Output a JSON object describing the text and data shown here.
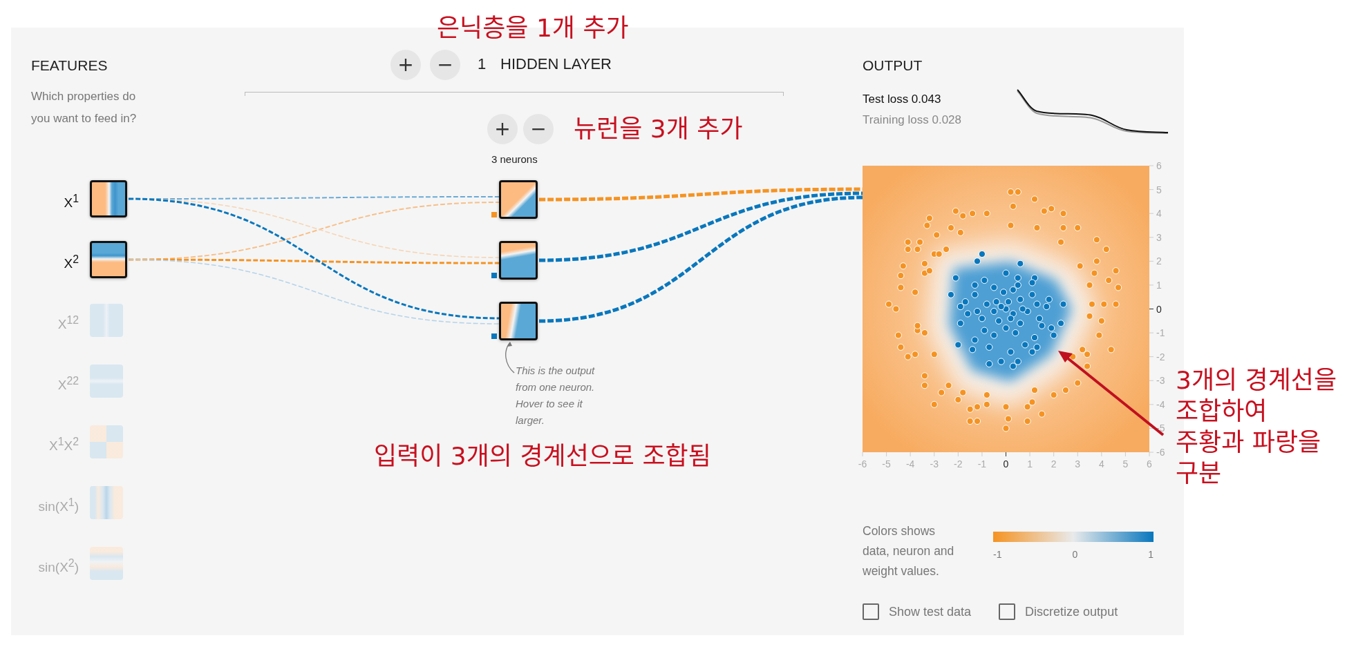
{
  "annotations": [
    {
      "lines": [
        "은닉층을 1개 추가"
      ]
    },
    {
      "lines": [
        "뉴런을 3개 추가"
      ]
    },
    {
      "lines": [
        "입력이 3개의 경계선으로 조합됨"
      ]
    },
    {
      "lines": [
        "3개의 경계선을",
        "조합하여",
        "주황과 파랑을",
        "구분"
      ]
    }
  ],
  "features": {
    "title": "FEATURES",
    "subtitle": [
      "Which properties do",
      "you want to feed in?"
    ],
    "items": [
      {
        "label": "X$^{1}$",
        "kind": "x1",
        "selected": true
      },
      {
        "label": "X$^{2}$",
        "kind": "x2",
        "selected": true
      },
      {
        "label": "X$^{12}$",
        "kind": "x1sq",
        "selected": false
      },
      {
        "label": "X$^{22}$",
        "kind": "x2sq",
        "selected": false
      },
      {
        "label": "X$^{1}$X$^{2}$",
        "kind": "product",
        "selected": false
      },
      {
        "label": "sin(X$^{1}$)",
        "kind": "sin1",
        "selected": false
      },
      {
        "label": "sin(X$^{2}$)",
        "kind": "sin2",
        "selected": false
      }
    ]
  },
  "hidden_layers": {
    "add_icon": "+",
    "remove_icon": "−",
    "count": "1",
    "label": "HIDDEN LAYER"
  },
  "layer": {
    "add_icon": "+",
    "remove_icon": "−",
    "neuron_count": "3 neurons",
    "neurons": [
      {
        "kind": "diagonal",
        "bias": {
          "color": "#f59322"
        },
        "output_link": {
          "color": "#f59322"
        },
        "inputs": [
          {
            "color": "#6aaad6",
            "kind": "medium"
          },
          {
            "color": "#f7bf8a",
            "kind": "medium"
          }
        ]
      },
      {
        "kind": "tilted-horizontal",
        "bias": {
          "color": "#0877bd"
        },
        "output_link": {
          "color": "#0877bd"
        },
        "inputs": [
          {
            "color": "#f6d5b5",
            "kind": "faint"
          },
          {
            "color": "#f59322",
            "kind": "strong"
          }
        ]
      },
      {
        "kind": "tilted-vertical",
        "bias": {
          "color": "#0877bd"
        },
        "output_link": {
          "color": "#0877bd"
        },
        "inputs": [
          {
            "color": "#0877bd",
            "kind": "strong"
          },
          {
            "color": "#b5d3ea",
            "kind": "faint"
          }
        ]
      }
    ]
  },
  "tooltip": [
    "This is the output",
    "from one neuron.",
    "Hover to see it",
    "larger."
  ],
  "output": {
    "title": "OUTPUT",
    "test_loss": "Test loss 0.043",
    "training_loss": "Training loss 0.028",
    "chart_data": {
      "type": "scatter",
      "xlim": [
        -6,
        6
      ],
      "ylim": [
        -6,
        6
      ],
      "xticks": [
        {
          "value": -6,
          "label": "-6"
        },
        {
          "value": -5,
          "label": "-5"
        },
        {
          "value": -4,
          "label": "-4"
        },
        {
          "value": -3,
          "label": "-3"
        },
        {
          "value": -2,
          "label": "-2"
        },
        {
          "value": -1,
          "label": "-1"
        },
        {
          "value": 0,
          "label": "0"
        },
        {
          "value": 1,
          "label": "1"
        },
        {
          "value": 2,
          "label": "2"
        },
        {
          "value": 3,
          "label": "3"
        },
        {
          "value": 4,
          "label": "4"
        },
        {
          "value": 5,
          "label": "5"
        },
        {
          "value": 6,
          "label": "6"
        }
      ],
      "yticks": [
        {
          "value": -6,
          "label": "-6"
        },
        {
          "value": -5,
          "label": "-5"
        },
        {
          "value": -4,
          "label": "-4"
        },
        {
          "value": -3,
          "label": "-3"
        },
        {
          "value": -2,
          "label": "-2"
        },
        {
          "value": -1,
          "label": "-1"
        },
        {
          "value": 0,
          "label": "0"
        },
        {
          "value": 1,
          "label": "1"
        },
        {
          "value": 2,
          "label": "2"
        },
        {
          "value": 3,
          "label": "3"
        },
        {
          "value": 4,
          "label": "4"
        },
        {
          "value": 5,
          "label": "5"
        },
        {
          "value": 6,
          "label": "6"
        }
      ],
      "series": [
        {
          "color": "#f59322",
          "x": [
            0.2,
            0.5,
            0.3,
            1.2,
            1.6,
            1.9,
            2.4,
            1.3,
            2.4,
            3.0,
            2.3,
            3.8,
            4.2,
            3.8,
            3.1,
            4.6,
            3.7,
            4.3,
            3.5,
            4.7,
            4.1,
            4.6,
            3.6,
            3.5,
            4.0,
            3.9,
            4.4,
            3.2,
            3.4,
            2.8,
            3.4,
            3.0,
            2.5,
            2.0,
            1.2,
            1.1,
            0.9,
            1.5,
            0.9,
            0.1,
            0,
            0,
            -0.8,
            -0.8,
            -1.2,
            -1.5,
            -1.2,
            -1.5,
            -1.8,
            -2.0,
            -2.7,
            -2.4,
            -3.0,
            -3.4,
            -3.4,
            -3.0,
            -3.8,
            -4.1,
            -4.4,
            -4.5,
            -3.7,
            -3.4,
            -3.7,
            -4.6,
            -4.9,
            -4.4,
            -4.4,
            -3.8,
            -4.3,
            -3.4,
            -3.2,
            -3.4,
            -4.1,
            -3.7,
            -3.6,
            -4.1,
            -3.0,
            -2.8,
            -2.5,
            -2.9,
            -2.3,
            -1.9,
            -3.2,
            -3.3,
            -2.1,
            -1.8,
            -1.4,
            -0.8,
            0.2
          ],
          "values": [
            4.9,
            4.9,
            4.3,
            4.6,
            4.1,
            4.2,
            4.0,
            3.4,
            3.4,
            3.4,
            2.8,
            2.9,
            2.5,
            2.0,
            1.8,
            1.6,
            1.5,
            1.2,
            1.0,
            0.9,
            0.2,
            0.2,
            0.2,
            -0.3,
            -0.5,
            -1.1,
            -1.7,
            -1.7,
            -1.9,
            -2.0,
            -2.4,
            -3.1,
            -3.4,
            -3.6,
            -3.4,
            -3.9,
            -4.1,
            -4.4,
            -4.7,
            -4.6,
            -5.0,
            -4.1,
            -3.6,
            -4.0,
            -4.1,
            -4.2,
            -4.7,
            -4.7,
            -3.5,
            -3.8,
            -3.5,
            -3.2,
            -4.0,
            -2.8,
            -3.2,
            -1.9,
            -1.9,
            -2.0,
            -1.6,
            -1.1,
            -0.9,
            -1.0,
            -0.7,
            0,
            0.2,
            1.4,
            0.9,
            0.7,
            1.8,
            1.5,
            1.6,
            1.9,
            2.5,
            2.5,
            2.8,
            2.8,
            2.3,
            2.3,
            2.5,
            3.1,
            3.4,
            3.2,
            3.8,
            3.5,
            4.1,
            3.9,
            4.0,
            4.0,
            3.5
          ]
        },
        {
          "color": "#0877bd",
          "x": [
            -1.0,
            -1.2,
            0.6,
            -2.1,
            -0.9,
            0,
            0.5,
            1.2,
            1.1,
            -1.3,
            -0.5,
            0.5,
            -2.3,
            -1.3,
            -0.1,
            0.3,
            1.1,
            1.8,
            2.4,
            -1.7,
            -1.9,
            -0.8,
            -0.4,
            0.1,
            0.6,
            1.3,
            1.7,
            -1.6,
            -1.2,
            -0.5,
            0,
            0.3,
            0.9,
            1.4,
            -1.9,
            -1.0,
            -0.3,
            0.6,
            1.5,
            2.3,
            -1.3,
            -0.9,
            0,
            0.4,
            1.2,
            2.0,
            1.9,
            -2.0,
            -1.4,
            -0.7,
            0.2,
            0.8,
            1.1,
            1.3,
            -0.7,
            -0.2,
            0.3,
            0.5,
            -0.5,
            0.7,
            -0.2,
            0.2
          ],
          "values": [
            2.3,
            2.0,
            1.9,
            1.3,
            1.2,
            1.5,
            1.3,
            1.3,
            1.1,
            1.0,
            0.9,
            1.0,
            0.6,
            0.6,
            0.7,
            0.8,
            0.6,
            0.4,
            0.2,
            0.3,
            0.1,
            0.2,
            0.3,
            0.3,
            0.4,
            0.2,
            0.1,
            -0.2,
            -0.1,
            -0.1,
            0,
            -0.2,
            -0.1,
            -0.4,
            -0.6,
            -0.4,
            -0.5,
            -0.6,
            -0.7,
            -0.6,
            -1.3,
            -0.9,
            -0.8,
            -1.0,
            -1.2,
            -1.1,
            -0.8,
            -1.5,
            -1.7,
            -1.6,
            -1.8,
            -1.5,
            -1.8,
            -1.6,
            -2.3,
            -2.2,
            -2.4,
            -2.2,
            -1.1,
            0,
            0.1,
            -0.4
          ]
        }
      ]
    },
    "legend": {
      "text": [
        "Colors shows",
        "data, neuron and",
        "weight values."
      ],
      "scale_labels": [
        "-1",
        "0",
        "1"
      ]
    },
    "options": [
      {
        "label": "Show test data",
        "checked": false
      },
      {
        "label": "Discretize output",
        "checked": false
      }
    ]
  }
}
